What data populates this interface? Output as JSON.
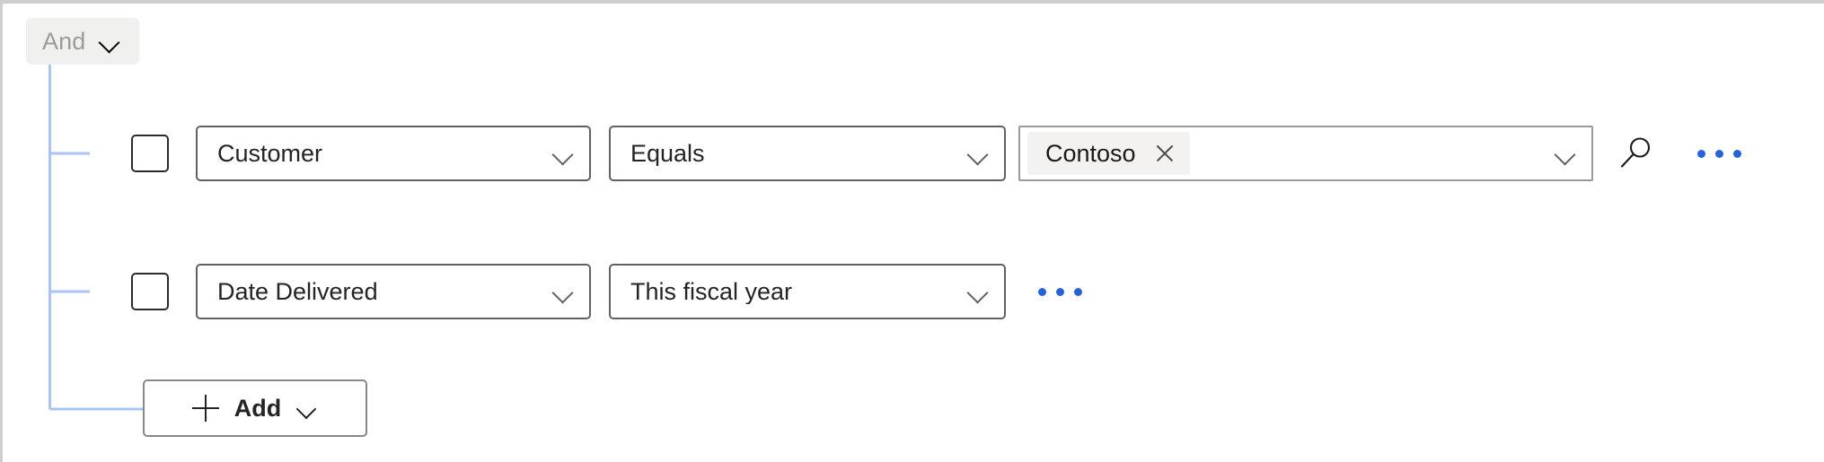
{
  "builder": {
    "group_operator": {
      "label": "And",
      "chevron_icon": "chevron-down-icon"
    },
    "connector_color": "#a9c5f5",
    "accent_color": "#2563d8",
    "rows": [
      {
        "checkbox_checked": false,
        "field": {
          "value": "Customer",
          "chevron_icon": "chevron-down-icon"
        },
        "operator": {
          "value": "Equals",
          "chevron_icon": "chevron-down-icon"
        },
        "value_control": {
          "type": "combobox-with-tags",
          "tags": [
            {
              "text": "Contoso",
              "remove_icon": "close-icon"
            }
          ],
          "chevron_icon": "chevron-down-icon"
        },
        "lookup_icon": "search-icon",
        "overflow_icon": "ellipsis-icon"
      },
      {
        "checkbox_checked": false,
        "field": {
          "value": "Date Delivered",
          "chevron_icon": "chevron-down-icon"
        },
        "operator": {
          "value": "This fiscal year",
          "chevron_icon": "chevron-down-icon"
        },
        "overflow_icon": "ellipsis-icon"
      }
    ],
    "add_button": {
      "label": "Add",
      "plus_icon": "plus-icon",
      "chevron_icon": "chevron-down-icon"
    }
  }
}
